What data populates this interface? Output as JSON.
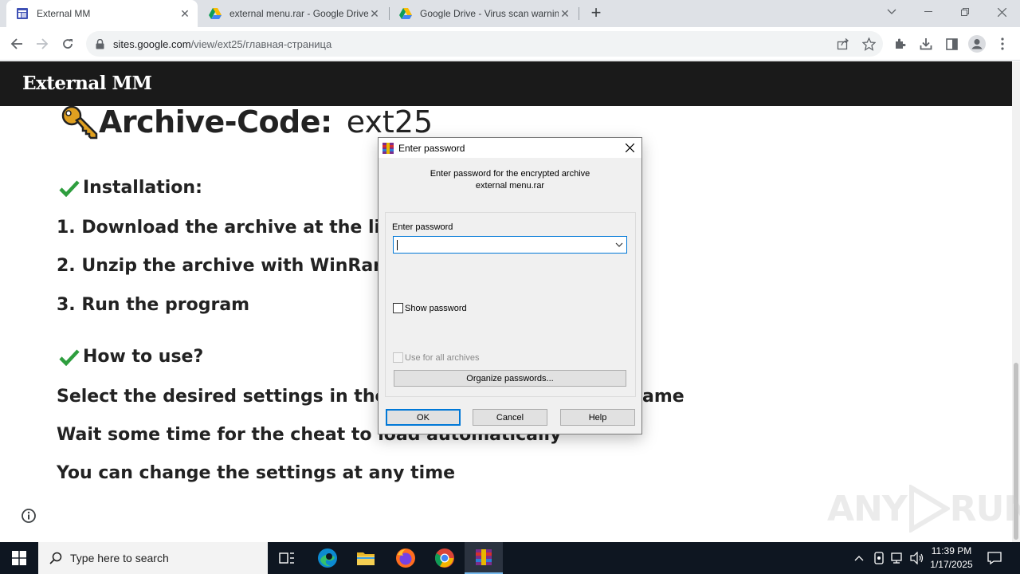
{
  "browser": {
    "tabs": [
      {
        "title": "External MM",
        "active": true
      },
      {
        "title": "external menu.rar - Google Drive",
        "active": false
      },
      {
        "title": "Google Drive - Virus scan warnin",
        "active": false
      }
    ],
    "url_host": "sites.google.com",
    "url_path": "/view/ext25/главная-страница"
  },
  "site": {
    "title": "External MM"
  },
  "content": {
    "archive_label": "Archive-Code:",
    "archive_code": "ext25",
    "installation_heading": "Installation:",
    "step1": "1. Download the archive at the lin",
    "step2": "2. Unzip the archive with WinRar",
    "step3": "3. Run the program",
    "howto_heading": "How to use?",
    "usage1": "Select the desired settings in the \"",
    "usage1_end": "ame",
    "usage2": "Wait some time for the cheat to load automatically",
    "usage3": "You can change the settings at any time"
  },
  "dialog": {
    "title": "Enter password",
    "message_line1": "Enter password for the encrypted archive",
    "message_line2": "external menu.rar",
    "field_label": "Enter password",
    "password_value": "",
    "show_password": "Show password",
    "use_for_all": "Use for all archives",
    "organize": "Organize passwords...",
    "ok": "OK",
    "cancel": "Cancel",
    "help": "Help"
  },
  "watermark": {
    "left": "ANY",
    "right": "RUN"
  },
  "taskbar": {
    "search_placeholder": "Type here to search",
    "time": "11:39 PM",
    "date": "1/17/2025"
  },
  "colors": {
    "site_header": "#1a1a1a",
    "accent": "#0078d7",
    "check_green": "#2e9e3e",
    "taskbar": "#0e1621"
  }
}
